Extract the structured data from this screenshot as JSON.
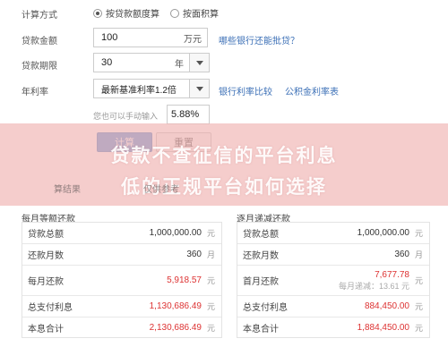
{
  "form": {
    "method_label": "计算方式",
    "method_options": [
      "按贷款额度算",
      "按面积算"
    ],
    "amount_label": "贷款金额",
    "amount_value": "100",
    "amount_unit": "万元",
    "amount_link": "哪些银行还能批贷？",
    "term_label": "贷款期限",
    "term_value": "30",
    "term_unit": "年",
    "rate_label": "年利率",
    "rate_select": "最新基准利率1.2倍",
    "rate_link1": "银行利率比较",
    "rate_link2": "公积金利率表",
    "manual_hint": "您也可以手动输入",
    "manual_rate": "5.88%",
    "calc_button": "计算",
    "reset_button": "重置"
  },
  "banner": {
    "line1": "贷款不查征信的平台利息",
    "line2": "低的正规平台如何选择"
  },
  "faded": {
    "left": "算结果",
    "mid": "仅供参考"
  },
  "equal_installment": {
    "title": "每月等额还款",
    "rows": [
      {
        "label": "贷款总额",
        "value": "1,000,000.00",
        "unit": "元",
        "red": false
      },
      {
        "label": "还款月数",
        "value": "360",
        "unit": "月",
        "red": false
      },
      {
        "label": "每月还款",
        "value": "5,918.57",
        "unit": "元",
        "red": true
      },
      {
        "label": "总支付利息",
        "value": "1,130,686.49",
        "unit": "元",
        "red": true
      },
      {
        "label": "本息合计",
        "value": "2,130,686.49",
        "unit": "元",
        "red": true
      }
    ]
  },
  "decreasing": {
    "title": "逐月递减还款",
    "rows": [
      {
        "label": "贷款总额",
        "value": "1,000,000.00",
        "unit": "元",
        "red": false
      },
      {
        "label": "还款月数",
        "value": "360",
        "unit": "月",
        "red": false
      },
      {
        "label": "首月还款",
        "value": "7,677.78",
        "unit": "元",
        "red": true,
        "sub": "每月递减：13.61 元"
      },
      {
        "label": "总支付利息",
        "value": "884,450.00",
        "unit": "元",
        "red": true
      },
      {
        "label": "本息合计",
        "value": "1,884,450.00",
        "unit": "元",
        "red": true
      }
    ]
  }
}
